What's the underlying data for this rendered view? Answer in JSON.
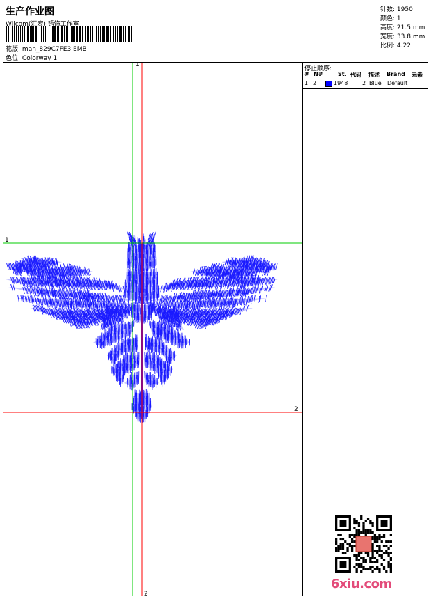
{
  "header": {
    "title": "生产作业图",
    "company": "Wilcom(汇宏) 锈饰工作室",
    "design_label": "花版:",
    "design_value": "man_829C7FE3.EMB",
    "colorway_label": "色位:",
    "colorway_value": "Colorway 1"
  },
  "stats": {
    "stitches_label": "针数:",
    "stitches": "1950",
    "colors_label": "颜色:",
    "colors": "1",
    "height_label": "高度:",
    "height": "21.5 mm",
    "width_label": "宽度:",
    "width": "33.8 mm",
    "scale_label": "比例:",
    "scale": "4.22"
  },
  "stop_sequence": {
    "title": "停止顺序:",
    "headers": [
      "#",
      "N#",
      "St.",
      "代码",
      "描述",
      "Brand",
      "元素"
    ],
    "rows": [
      {
        "index": "1.",
        "needle": "2",
        "stitches": "1948",
        "code": "2",
        "description": "Blue",
        "brand": "Default",
        "swatch_color": "#0000ff"
      }
    ]
  },
  "guides": {
    "green_color": "#00cc00",
    "red_color": "#ff0000",
    "green_h_label": "1",
    "green_v_label": "1",
    "red_h_label": "2",
    "red_v_label": "2"
  },
  "design_colors": {
    "stitch": "#1a1aff"
  },
  "watermark": "6xiu.com"
}
